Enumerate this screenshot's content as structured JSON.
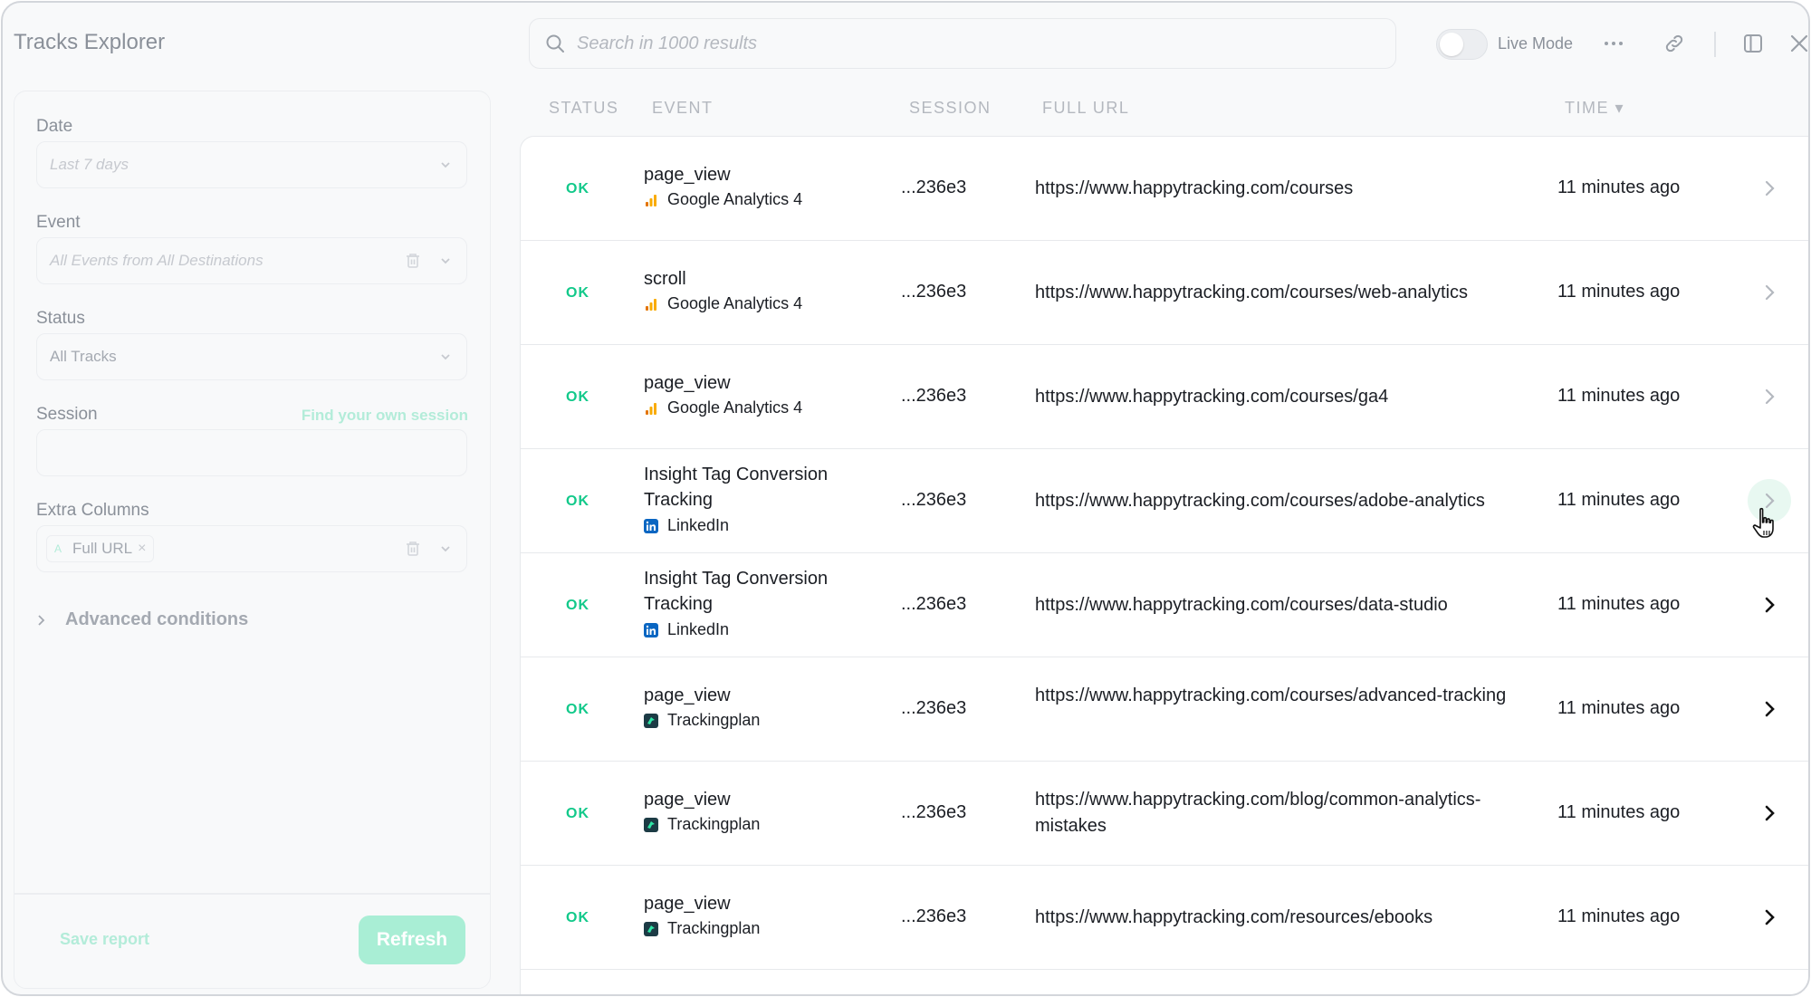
{
  "app": {
    "title": "Tracks Explorer"
  },
  "search": {
    "placeholder": "Search in 1000 results"
  },
  "toolbar": {
    "live_mode_label": "Live Mode",
    "live_mode_on": false
  },
  "filters": {
    "date": {
      "label": "Date",
      "placeholder": "Last 7 days"
    },
    "event": {
      "label": "Event",
      "placeholder": "All Events from All Destinations"
    },
    "status": {
      "label": "Status",
      "value": "All Tracks"
    },
    "session": {
      "label": "Session",
      "link": "Find your own session",
      "value": ""
    },
    "extra_columns": {
      "label": "Extra Columns",
      "chips": [
        {
          "prefix": "A",
          "label": "Full URL"
        }
      ]
    },
    "advanced_label": "Advanced conditions",
    "save_report_label": "Save report",
    "refresh_label": "Refresh"
  },
  "table": {
    "headers": {
      "status": "STATUS",
      "event": "EVENT",
      "session": "SESSION",
      "full_url": "FULL URL",
      "time": "TIME ▾"
    },
    "rows": [
      {
        "status": "OK",
        "event": "page_view",
        "destination": "Google Analytics 4",
        "dest_icon": "ga4-icon",
        "session": "...236e3",
        "url": "https://www.happytracking.com/courses",
        "time": "11 minutes ago"
      },
      {
        "status": "OK",
        "event": "scroll",
        "destination": "Google Analytics 4",
        "dest_icon": "ga4-icon",
        "session": "...236e3",
        "url": "https://www.happytracking.com/courses/web-analytics",
        "time": "11 minutes ago"
      },
      {
        "status": "OK",
        "event": "page_view",
        "destination": "Google Analytics 4",
        "dest_icon": "ga4-icon",
        "session": "...236e3",
        "url": "https://www.happytracking.com/courses/ga4",
        "time": "11 minutes ago"
      },
      {
        "status": "OK",
        "event": "Insight Tag Conversion Tracking",
        "destination": "LinkedIn",
        "dest_icon": "linkedin-icon",
        "session": "...236e3",
        "url": "https://www.happytracking.com/courses/adobe-analytics",
        "time": "11 minutes ago"
      },
      {
        "status": "OK",
        "event": "Insight Tag Conversion Tracking",
        "destination": "LinkedIn",
        "dest_icon": "linkedin-icon",
        "session": "...236e3",
        "url": "https://www.happytracking.com/courses/data-studio",
        "time": "11 minutes ago"
      },
      {
        "status": "OK",
        "event": "page_view",
        "destination": "Trackingplan",
        "dest_icon": "trackingplan-icon",
        "session": "...236e3",
        "url": "https://www.happytracking.com/courses/advanced-tracking",
        "time": "11 minutes ago"
      },
      {
        "status": "OK",
        "event": "page_view",
        "destination": "Trackingplan",
        "dest_icon": "trackingplan-icon",
        "session": "...236e3",
        "url": "https://www.happytracking.com/blog/common-analytics-mistakes",
        "time": "11 minutes ago"
      },
      {
        "status": "OK",
        "event": "page_view",
        "destination": "Trackingplan",
        "dest_icon": "trackingplan-icon",
        "session": "...236e3",
        "url": "https://www.happytracking.com/resources/ebooks",
        "time": "11 minutes ago"
      }
    ]
  },
  "colors": {
    "accent": "#12c98a",
    "accent_light": "#a9eed5",
    "ga4": "#f9ab00",
    "linkedin": "#0a66c2",
    "trackingplan": "#1c3b45"
  }
}
